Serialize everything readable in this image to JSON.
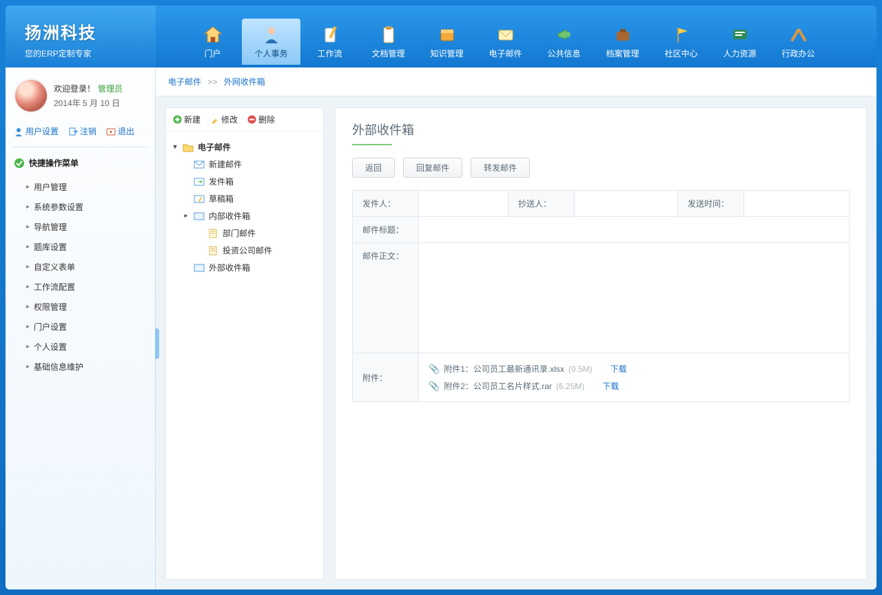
{
  "logo": {
    "title": "扬洲科技",
    "subtitle": "您的ERP定制专家"
  },
  "topnav": [
    {
      "label": "门户"
    },
    {
      "label": "个人事务"
    },
    {
      "label": "工作流"
    },
    {
      "label": "文档管理"
    },
    {
      "label": "知识管理"
    },
    {
      "label": "电子邮件"
    },
    {
      "label": "公共信息"
    },
    {
      "label": "档案管理"
    },
    {
      "label": "社区中心"
    },
    {
      "label": "人力资源"
    },
    {
      "label": "行政办公"
    }
  ],
  "user": {
    "welcome": "欢迎登录！",
    "role": "管理员",
    "date": "2014年 5 月 10 日"
  },
  "user_actions": {
    "settings": "用户设置",
    "logout": "注销",
    "exit": "退出"
  },
  "quick": {
    "title": "快捷操作菜单",
    "items": [
      "用户管理",
      "系统参数设置",
      "导航管理",
      "题库设置",
      "自定义表单",
      "工作流配置",
      "权限管理",
      "门户设置",
      "个人设置",
      "基础信息维护"
    ]
  },
  "crumb": {
    "a": "电子邮件",
    "sep": ">>",
    "b": "外网收件箱"
  },
  "tree_tb": {
    "new": "新建",
    "edit": "修改",
    "del": "删除"
  },
  "tree": {
    "root": "电子邮件",
    "new_mail": "新建邮件",
    "outbox": "发件箱",
    "draft": "草稿箱",
    "inbox_int": "内部收件箱",
    "dept": "部门邮件",
    "invest": "投资公司邮件",
    "inbox_ext": "外部收件箱"
  },
  "detail": {
    "title": "外部收件箱",
    "btn_back": "返回",
    "btn_reply": "回复邮件",
    "btn_forward": "转发邮件",
    "lbl_from": "发件人：",
    "lbl_cc": "抄送人：",
    "lbl_time": "发送时间：",
    "lbl_subject": "邮件标题：",
    "lbl_body": "邮件正文：",
    "lbl_att": "附件：",
    "att": [
      {
        "prefix": "附件1：",
        "name": "公司员工最新通讯录.xlsx",
        "size": "(0.5M)",
        "dl": "下载"
      },
      {
        "prefix": "附件2：",
        "name": "公司员工名片样式.rar",
        "size": "(6.25M)",
        "dl": "下载"
      }
    ]
  }
}
